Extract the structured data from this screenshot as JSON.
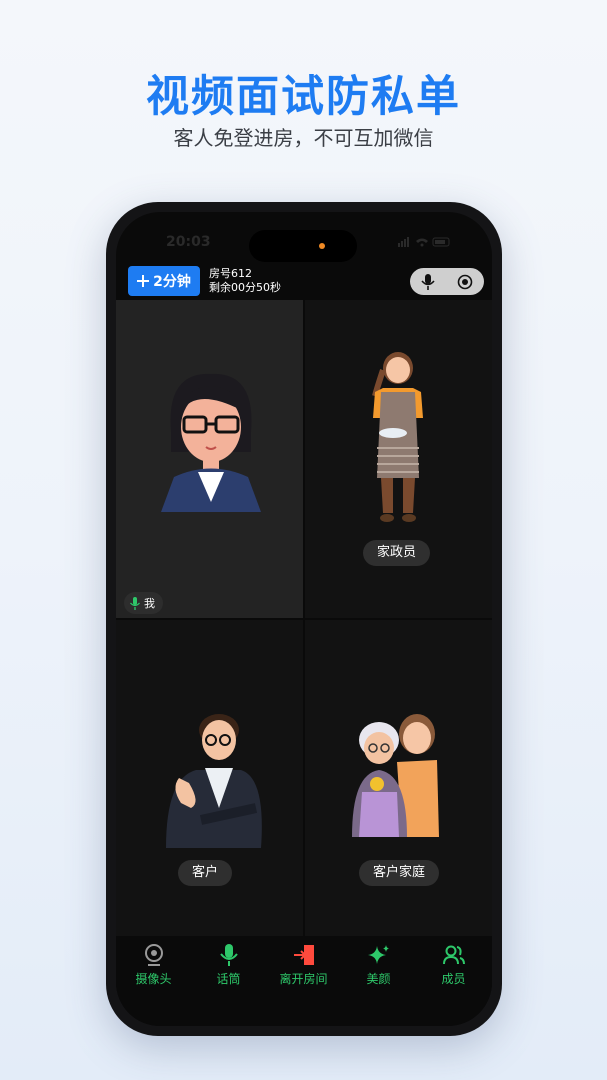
{
  "promo": {
    "title": "视频面试防私单",
    "subtitle": "客人免登进房，不可互加微信"
  },
  "status_bar": {
    "time": "20:03"
  },
  "header": {
    "add_time_label": "2分钟",
    "room_label": "房号612",
    "remaining_label": "剩余00分50秒"
  },
  "tiles": {
    "self": {
      "label": "我"
    },
    "housekeeper": {
      "label": "家政员"
    },
    "customer": {
      "label": "客户"
    },
    "customer_family": {
      "label": "客户家庭"
    }
  },
  "toolbar": {
    "camera": "摄像头",
    "mic": "话筒",
    "leave": "离开房间",
    "beauty": "美颜",
    "members": "成员"
  },
  "colors": {
    "accent": "#1e7cf2",
    "active_green": "#2ec86a",
    "leave_red": "#ff4a3d",
    "camera_gray": "#9a9a9a"
  }
}
